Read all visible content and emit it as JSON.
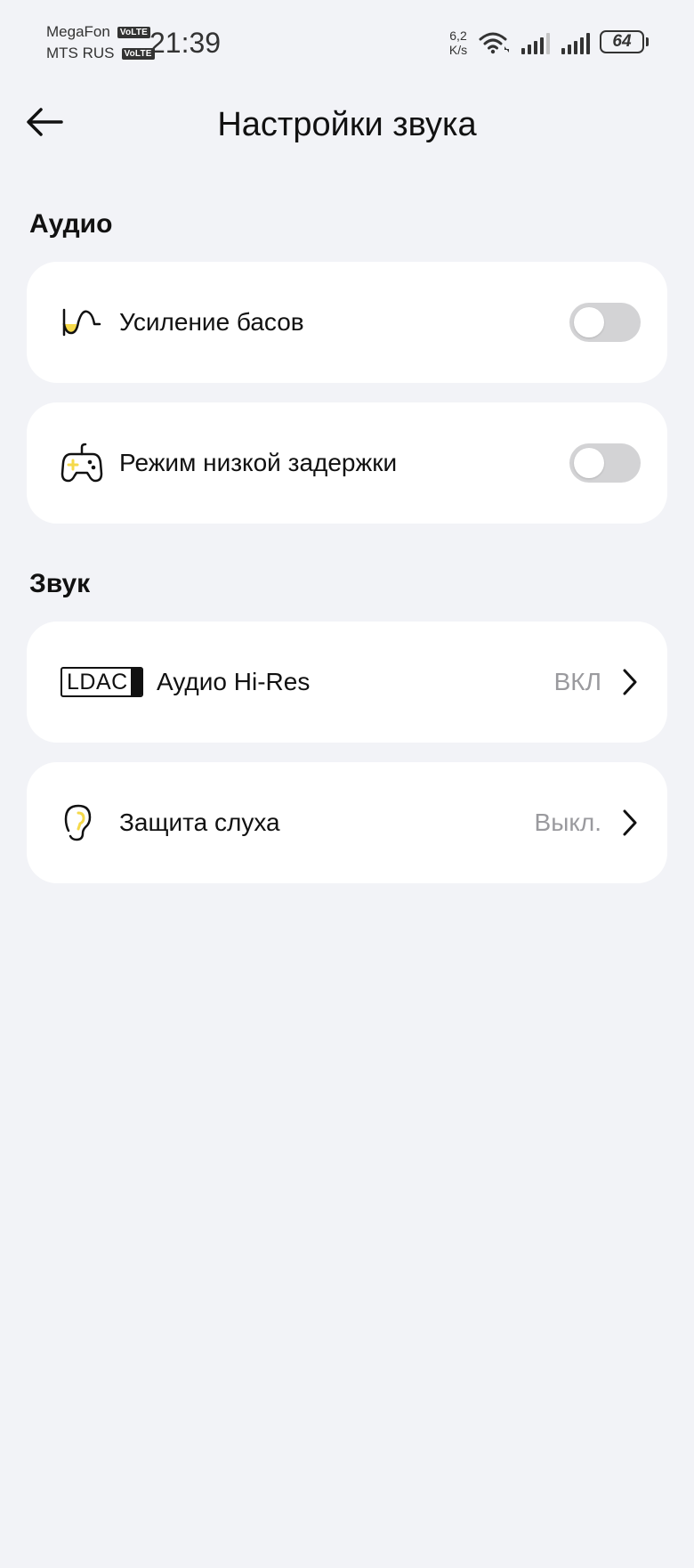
{
  "status_bar": {
    "carrier1": "MegaFon",
    "carrier2": "MTS RUS",
    "volte1": "VoLTE",
    "volte2": "VoLTE",
    "time": "21:39",
    "net_speed_value": "6,2",
    "net_speed_unit": "K/s",
    "battery_level": "64",
    "icons": [
      "wifi-icon",
      "signal-icon",
      "signal-icon"
    ]
  },
  "header": {
    "title": "Настройки звука",
    "back_icon": "arrow-left-icon"
  },
  "sections": {
    "audio": {
      "heading": "Аудио",
      "items": [
        {
          "label": "Усиление басов",
          "icon": "bass-wave-icon",
          "toggle_on": false
        },
        {
          "label": "Режим низкой задержки",
          "icon": "gamepad-icon",
          "toggle_on": false
        }
      ]
    },
    "sound": {
      "heading": "Звук",
      "items": [
        {
          "label": "Аудио Hi-Res",
          "icon": "ldac-icon",
          "icon_text": "LDAC",
          "value": "ВКЛ"
        },
        {
          "label": "Защита слуха",
          "icon": "ear-icon",
          "value": "Выкл."
        }
      ]
    }
  },
  "colors": {
    "background": "#f2f3f7",
    "card": "#ffffff",
    "toggle_off": "#d3d3d5",
    "value_text": "#9a9a9e",
    "accent_yellow": "#f5d94a"
  }
}
